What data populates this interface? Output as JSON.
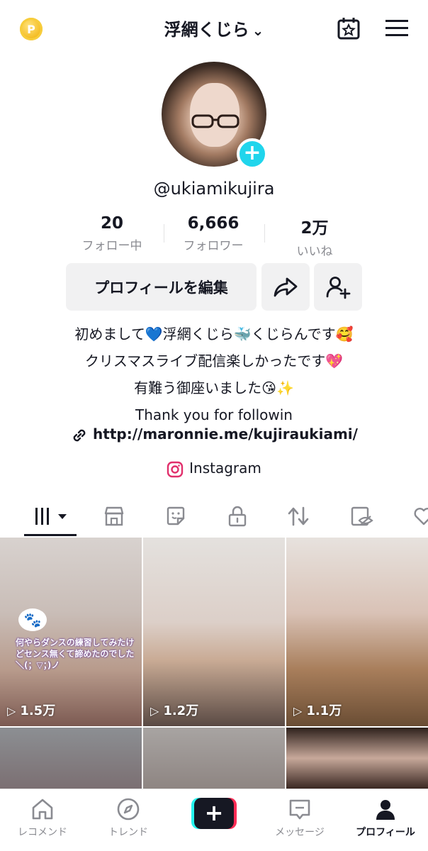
{
  "header": {
    "coin_icon": "coin-icon",
    "coin_glyph": "P",
    "title": "浮網くじら",
    "chevron": "⌄",
    "calendar_icon": "calendar-star-icon",
    "menu_icon": "hamburger-menu-icon"
  },
  "profile": {
    "username": "@ukiamikujira",
    "add_glyph": "+",
    "stats": [
      {
        "value": "20",
        "label": "フォロー中"
      },
      {
        "value": "6,666",
        "label": "フォロワー"
      },
      {
        "value": "2万",
        "label": "いいね"
      }
    ],
    "edit_button": "プロフィールを編集",
    "bio": [
      "初めまして💙浮網くじら🐳くじらんです🥰",
      "クリスマスライブ配信楽しかったです💖",
      "有難う御座いました😘✨",
      "Thank you for followin"
    ],
    "link": "http://maronnie.me/kujiraukiami/",
    "instagram": "Instagram"
  },
  "tabs": [
    {
      "icon": "videos-grid-icon"
    },
    {
      "icon": "shop-icon"
    },
    {
      "icon": "sticker-icon"
    },
    {
      "icon": "lock-icon"
    },
    {
      "icon": "repost-icon"
    },
    {
      "icon": "hidden-eye-icon"
    },
    {
      "icon": "liked-heart-icon"
    }
  ],
  "videos": [
    {
      "views": "1.5万",
      "caption": "何やらダンスの練習してみたけどセンス無くて諦めたのでした＼(；▽；)ノ"
    },
    {
      "views": "1.2万"
    },
    {
      "views": "1.1万"
    },
    {
      "views": ""
    },
    {
      "views": ""
    },
    {
      "views": ""
    }
  ],
  "bottom_nav": [
    {
      "label": "レコメンド",
      "icon": "home-icon"
    },
    {
      "label": "トレンド",
      "icon": "compass-icon"
    },
    {
      "label": "",
      "icon": "create-plus-icon",
      "glyph": "+"
    },
    {
      "label": "メッセージ",
      "icon": "inbox-message-icon"
    },
    {
      "label": "プロフィール",
      "icon": "profile-person-icon"
    }
  ],
  "colors": {
    "accent_cyan": "#20d5ec",
    "tiktok_red": "#fe2c55",
    "tiktok_cyan": "#25f4ee",
    "text_dark": "#161823",
    "text_gray": "#8a8b91",
    "button_bg": "#f1f1f2"
  }
}
